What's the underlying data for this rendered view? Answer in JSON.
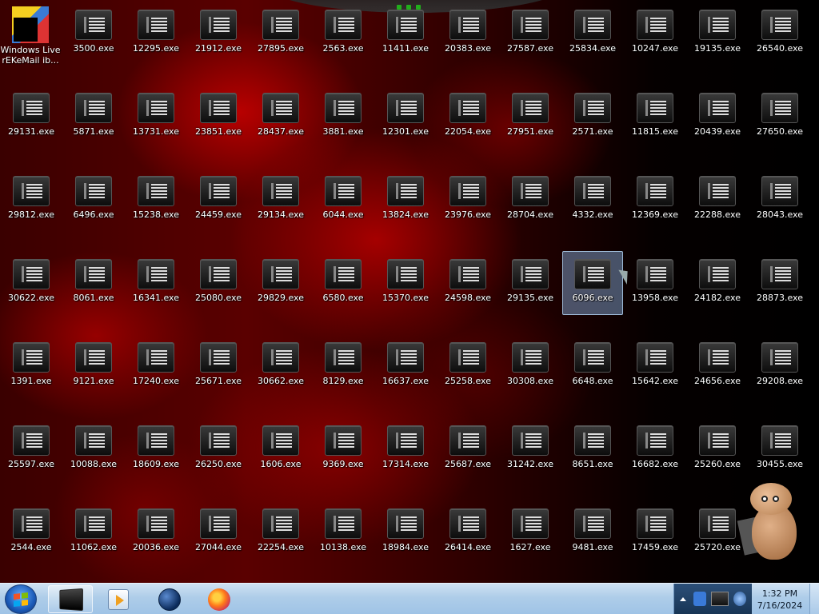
{
  "desktop": {
    "special_icon": {
      "label_line1": "Windows Live",
      "label_line2": "rEKeMail ib..."
    },
    "selected_label": "6096.exe",
    "rows": [
      [
        "",
        "3500.exe",
        "12295.exe",
        "21912.exe",
        "27895.exe",
        "2563.exe",
        "11411.exe",
        "20383.exe",
        "27587.exe",
        "25834.exe",
        "10247.exe",
        "19135.exe",
        "26540.exe"
      ],
      [
        "29131.exe",
        "5871.exe",
        "13731.exe",
        "23851.exe",
        "28437.exe",
        "3881.exe",
        "12301.exe",
        "22054.exe",
        "27951.exe",
        "2571.exe",
        "11815.exe",
        "20439.exe",
        "27650.exe"
      ],
      [
        "29812.exe",
        "6496.exe",
        "15238.exe",
        "24459.exe",
        "29134.exe",
        "6044.exe",
        "13824.exe",
        "23976.exe",
        "28704.exe",
        "4332.exe",
        "12369.exe",
        "22288.exe",
        "28043.exe"
      ],
      [
        "30622.exe",
        "8061.exe",
        "16341.exe",
        "25080.exe",
        "29829.exe",
        "6580.exe",
        "15370.exe",
        "24598.exe",
        "29135.exe",
        "6096.exe",
        "13958.exe",
        "24182.exe",
        "28873.exe"
      ],
      [
        "1391.exe",
        "9121.exe",
        "17240.exe",
        "25671.exe",
        "30662.exe",
        "8129.exe",
        "16637.exe",
        "25258.exe",
        "30308.exe",
        "6648.exe",
        "15642.exe",
        "24656.exe",
        "29208.exe"
      ],
      [
        "25597.exe",
        "10088.exe",
        "18609.exe",
        "26250.exe",
        "1606.exe",
        "9369.exe",
        "17314.exe",
        "25687.exe",
        "31242.exe",
        "8651.exe",
        "16682.exe",
        "25260.exe",
        "30455.exe"
      ],
      [
        "2544.exe",
        "11062.exe",
        "20036.exe",
        "27044.exe",
        "22254.exe",
        "10138.exe",
        "18984.exe",
        "26414.exe",
        "1627.exe",
        "9481.exe",
        "17459.exe",
        "25720.exe",
        ""
      ]
    ]
  },
  "taskbar": {
    "start_icon": "windows-flag-icon",
    "pinned": [
      {
        "name": "taskbar-monitor-app",
        "icon": "monitor-icon"
      },
      {
        "name": "taskbar-media-player",
        "icon": "media-player-icon"
      },
      {
        "name": "taskbar-globe-app",
        "icon": "globe-icon"
      },
      {
        "name": "taskbar-firefox",
        "icon": "firefox-icon"
      }
    ],
    "tray_icons": [
      "show-hidden-icons-icon",
      "bluetooth-icon",
      "network-icon",
      "volume-icon"
    ],
    "clock": {
      "time": "1:32 PM",
      "date": "7/16/2024"
    }
  }
}
